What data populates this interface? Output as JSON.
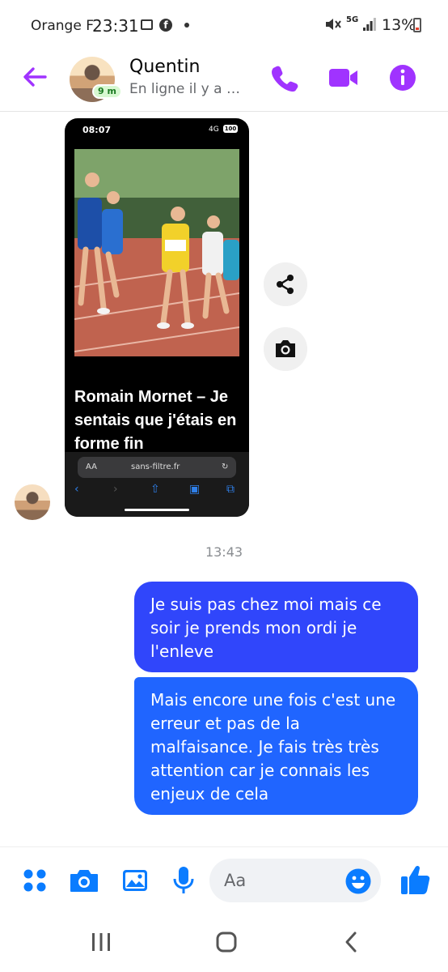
{
  "status_bar": {
    "carrier": "Orange F",
    "time": "23:31",
    "network": "5G",
    "battery": "13%"
  },
  "header": {
    "contact_name": "Quentin",
    "status": "En ligne il y a 9…",
    "active_badge": "9 m",
    "accent_color": "#a033ff"
  },
  "shared_screenshot": {
    "phone_time": "08:07",
    "phone_network": "4G",
    "phone_battery": "100",
    "headline": "Romain Mornet – Je sentais que j'étais en forme fin",
    "url_aa": "AA",
    "url": "sans-filtre.fr"
  },
  "conversation": {
    "timestamp": "13:43",
    "messages": [
      {
        "from": "me",
        "text": "Je suis pas chez moi mais ce soir je prends mon ordi je l'enleve"
      },
      {
        "from": "me",
        "text": "Mais encore une fois c'est une erreur et pas de la malfaisance. Je fais très très attention car je connais les enjeux de cela"
      }
    ]
  },
  "composer": {
    "placeholder": "Aa",
    "icon_color": "#0a7cff"
  }
}
